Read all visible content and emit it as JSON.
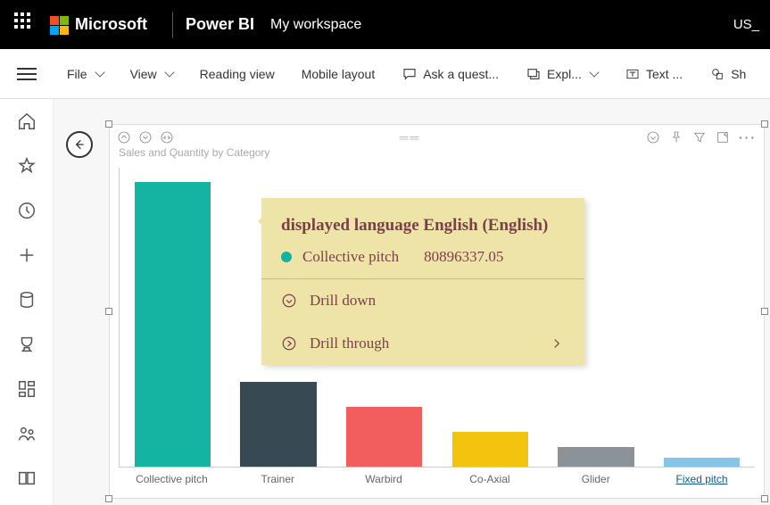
{
  "topbar": {
    "microsoft": "Microsoft",
    "product": "Power BI",
    "workspace": "My workspace",
    "locale_short": "US_"
  },
  "toolbar": {
    "file": "File",
    "view": "View",
    "reading_view": "Reading view",
    "mobile_layout": "Mobile layout",
    "ask": "Ask a quest...",
    "explore": "Expl...",
    "text": "Text ...",
    "shapes": "Sh"
  },
  "visual": {
    "title": "Sales and Quantity by Category"
  },
  "tooltip": {
    "header": "displayed language English (English)",
    "series_label": "Collective pitch",
    "series_value": "80896337.05",
    "drill_down": "Drill down",
    "drill_through": "Drill through",
    "dot_color": "#12b3a0"
  },
  "chart_data": {
    "type": "bar",
    "title": "Sales and Quantity by Category",
    "xlabel": "",
    "ylabel": "",
    "ylim": [
      0,
      85000000
    ],
    "categories": [
      "Collective pitch",
      "Trainer",
      "Warbird",
      "Co-Axial",
      "Glider",
      "Fixed pitch"
    ],
    "values": [
      80896337.05,
      24000000,
      17000000,
      10000000,
      5500000,
      2500000
    ],
    "colors": [
      "#14b3a2",
      "#374a54",
      "#f25d5d",
      "#f2c40e",
      "#8b9298",
      "#86c5e8"
    ]
  }
}
